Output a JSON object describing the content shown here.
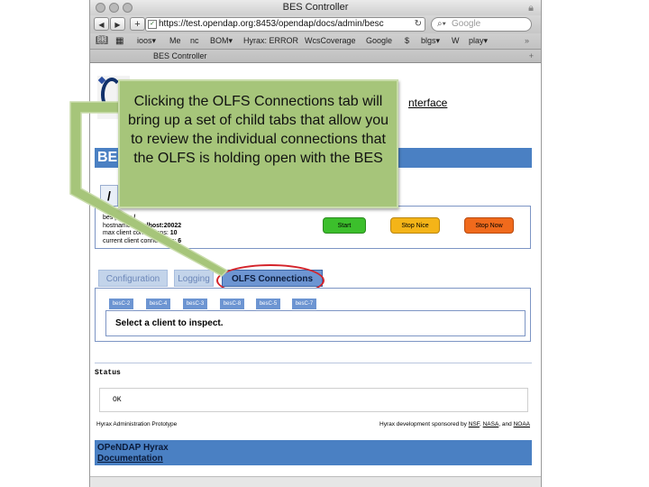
{
  "window": {
    "title": "BES Controller",
    "url": "https://test.opendap.org:8453/opendap/docs/admin/besc",
    "search_placeholder": "Google",
    "tab_title": "BES Controller",
    "bookmarks": [
      "ioos▾",
      "Me",
      "nc",
      "BOM▾",
      "Hyrax: ERROR",
      "WcsCoverage",
      "Google",
      "$",
      "blgs▾",
      "W",
      "play▾"
    ]
  },
  "page": {
    "header_link": "nterface",
    "banner": "BES",
    "prefix_tab": "/",
    "info": {
      "prefix_label": "bes prefix:",
      "prefix_value": "/",
      "hostname_label": "hostname:",
      "hostname_value": "localhost:20022",
      "max_label": "max client connections:",
      "max_value": "10",
      "current_label": "current client connections:",
      "current_value": "6"
    },
    "buttons": {
      "start": "Start",
      "stop_nice": "Stop Nice",
      "stop_now": "Stop Now"
    },
    "colors": {
      "start": "#3cbf2c",
      "stop_nice": "#f4b418",
      "stop_now": "#f06a1c",
      "banner_blue": "#4a80c3",
      "callout_green": "#a6c57a",
      "highlight_red": "#d4232a"
    },
    "tabs": [
      "Configuration",
      "Logging",
      "OLFS Connections"
    ],
    "child_tabs": [
      "besC-2",
      "besC-4",
      "besC-3",
      "besC-8",
      "besC-5",
      "besC-7"
    ],
    "select_prompt": "Select a client to inspect.",
    "status_title": "Status",
    "status_value": "OK",
    "footer_left": "Hyrax Administration Prototype",
    "footer_right": {
      "prefix": "Hyrax development sponsored by",
      "nsf": "NSF",
      "sep1": ",",
      "nasa": "NASA",
      "sep2": ", and",
      "noaa": "NOAA"
    },
    "bottom_bar": {
      "line1": "OPeNDAP Hyrax",
      "line2": "Documentation"
    }
  },
  "callout": {
    "text": "Clicking the OLFS Connections tab will bring up a set of child tabs that allow you to review the individual connections that the OLFS is holding open with the BES"
  }
}
